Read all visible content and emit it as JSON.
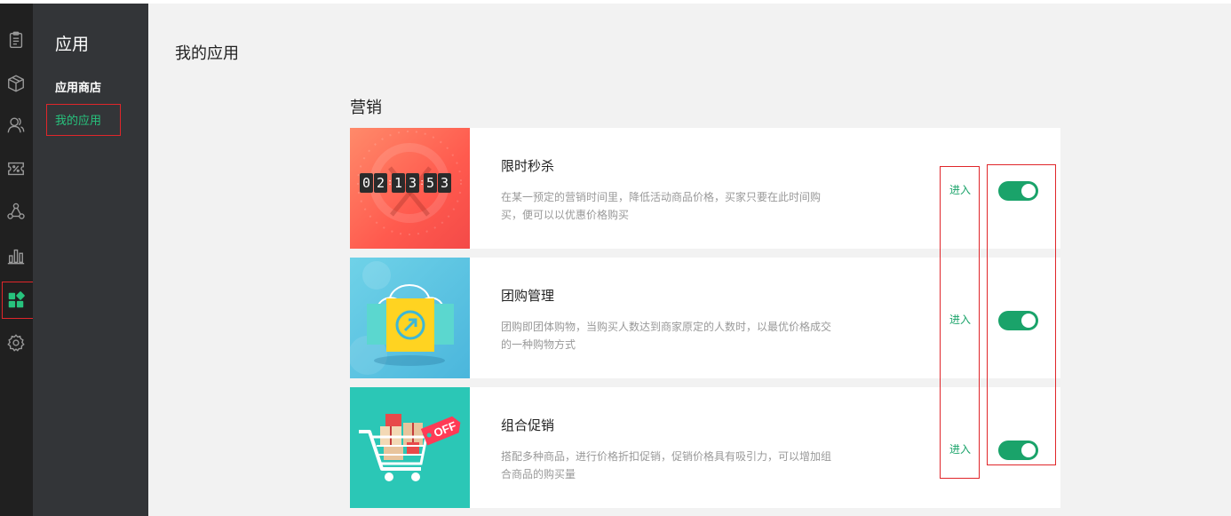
{
  "sidebar": {
    "title": "应用",
    "items": [
      {
        "label": "应用商店"
      },
      {
        "label": "我的应用"
      }
    ]
  },
  "iconbar": {
    "icons": [
      "clipboard-icon",
      "box-icon",
      "users-icon",
      "coupon-icon",
      "network-icon",
      "bar-chart-icon",
      "apps-icon",
      "settings-icon"
    ]
  },
  "main": {
    "page_title": "我的应用",
    "section_title": "营销",
    "apps": [
      {
        "name": "限时秒杀",
        "desc": "在某一预定的营销时间里，降低活动商品价格，买家只要在此时间购买，便可以以优惠价格购买",
        "enter": "进入",
        "enabled": true,
        "timer": [
          "0",
          "2",
          "1",
          "3",
          "5",
          "3"
        ]
      },
      {
        "name": "团购管理",
        "desc": "团购即团体购物，当购买人数达到商家原定的人数时，以最优价格成交的一种购物方式",
        "enter": "进入",
        "enabled": true
      },
      {
        "name": "组合促销",
        "desc": "搭配多种商品，进行价格折扣促销，促销价格具有吸引力，可以增加组合商品的购买量",
        "enter": "进入",
        "enabled": true,
        "badge": "OFF"
      }
    ]
  },
  "colors": {
    "accent": "#1aa36a",
    "highlight": "#e0262a",
    "sidebar_bg": "#333538",
    "iconbar_bg": "#202020"
  }
}
